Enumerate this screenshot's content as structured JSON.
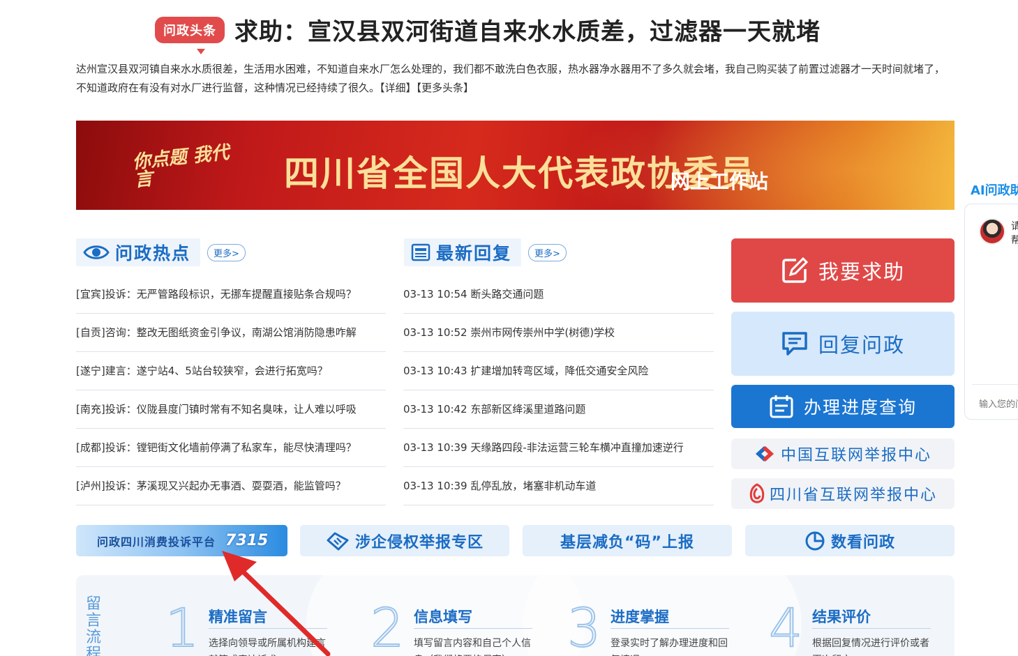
{
  "headline": {
    "badge": "问政头条",
    "title": "求助：宣汉县双河街道自来水水质差，过滤器一天就堵",
    "summary": "达州宣汉县双河镇自来水水质很差，生活用水困难，不知道自来水厂怎么处理的，我们都不敢洗白色衣服，热水器净水器用不了多久就会堵，我自己购买装了前置过滤器才一天时间就堵了，不知道政府在有没有对水厂进行监督，这种情况已经持续了很久。",
    "detail_link": "【详细】",
    "more_link": "【更多头条】"
  },
  "banner": {
    "slogan": "你点题 我代言",
    "title": "四川省全国人大代表政协委员",
    "subtitle": "网上工作站"
  },
  "hot": {
    "title": "问政热点",
    "more": "更多>",
    "items": [
      "[宜宾]投诉：无严管路段标识，无挪车提醒直接贴条合规吗？",
      "[自贡]咨询：整改无图纸资金引争议，南湖公馆消防隐患咋解",
      "[遂宁]建言：遂宁站4、5站台较狭窄，会进行拓宽吗？",
      "[南充]投诉：仪陇县度门镇时常有不知名臭味，让人难以呼吸",
      "[成都]投诉：镗钯街文化墙前停满了私家车，能尽快清理吗？",
      "[泸州]投诉：茅溪现又兴起办无事酒、耍耍酒，能监管吗？"
    ]
  },
  "latest": {
    "title": "最新回复",
    "more": "更多>",
    "items": [
      "03-13 10:54 断头路交通问题",
      "03-13 10:52 崇州市网传崇州中学(树德)学校",
      "03-13 10:43 扩建增加转弯区域，降低交通安全风险",
      "03-13 10:42 东部新区绛溪里道路问题",
      "03-13 10:39 天缘路四段-非法运营三轮车横冲直撞加速逆行",
      "03-13 10:39 乱停乱放，堵塞非机动车道"
    ]
  },
  "actions": {
    "help": "我要求助",
    "reply": "回复问政",
    "progress": "办理进度查询",
    "report_cn": "中国互联网举报中心",
    "report_sc": "四川省互联网举报中心"
  },
  "tiles": {
    "consumer": "问政四川消费投诉平台",
    "consumer_logo": "7315",
    "enterprise": "涉企侵权举报专区",
    "burden": "基层减负“码”上报",
    "data": "数看问政"
  },
  "process": {
    "label": "留言流程",
    "steps": [
      {
        "num": "1",
        "title": "精准留言",
        "desc": "选择向领导或所属机构建言献策或表达诉求"
      },
      {
        "num": "2",
        "title": "信息填写",
        "desc": "填写留言内容和自己个人信息（我们将严格保密）"
      },
      {
        "num": "3",
        "title": "进度掌握",
        "desc": "登录实时了解办理进度和回复情况"
      },
      {
        "num": "4",
        "title": "结果评价",
        "desc": "根据回复情况进行评价或者再次留言"
      }
    ]
  },
  "ai": {
    "title": "AI问政助手",
    "greeting": "请帮",
    "input_placeholder": "输入您的问题"
  },
  "colors": {
    "brand_blue": "#1b6cc4",
    "help_red": "#e04848",
    "badge_red": "#e14b4b"
  }
}
